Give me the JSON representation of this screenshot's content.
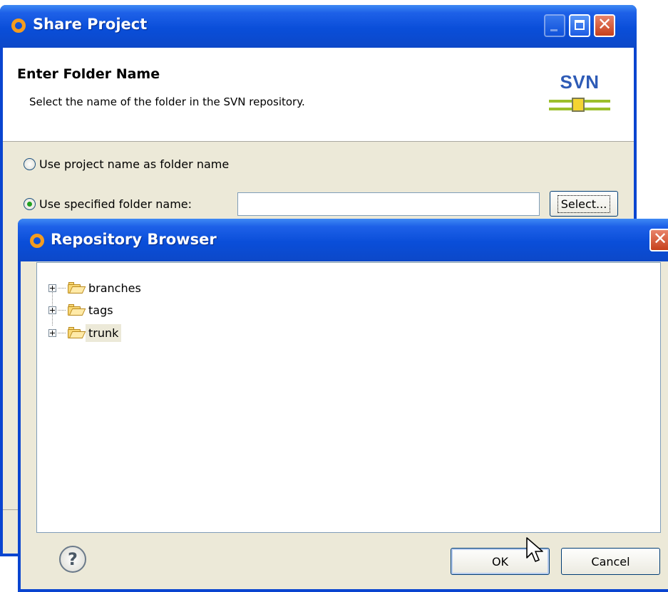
{
  "share_project": {
    "title": "Share Project",
    "heading": "Enter Folder Name",
    "description": "Select the name of the folder in the SVN repository.",
    "logo_text": "SVN",
    "option_project_name": "Use project name as folder name",
    "option_specified": "Use specified folder name:",
    "folder_name_value": "",
    "select_button": "Select..."
  },
  "repository_browser": {
    "title": "Repository Browser",
    "tree_items": [
      {
        "label": "branches"
      },
      {
        "label": "tags"
      },
      {
        "label": "trunk"
      }
    ],
    "ok_button": "OK",
    "cancel_button": "Cancel",
    "help_glyph": "?"
  },
  "colors": {
    "titlebar": "#0a4ed9",
    "window_bg": "#ece9d8",
    "svn_logo": "#2e5bb6",
    "folder": "#f8d775"
  },
  "icons": [
    "eclipse-app-icon",
    "minimize-icon",
    "maximize-icon",
    "close-icon",
    "svn-logo",
    "expander-plus-icon",
    "folder-icon",
    "help-icon",
    "mouse-pointer-icon"
  ]
}
